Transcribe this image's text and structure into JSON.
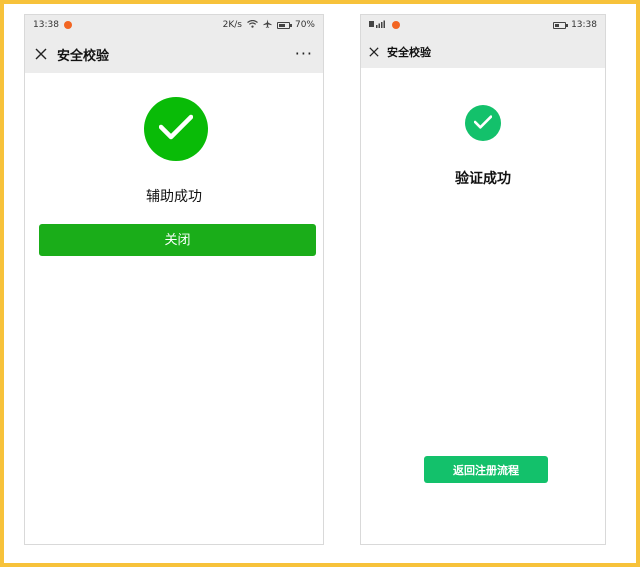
{
  "left_screen": {
    "status_bar": {
      "time": "13:38",
      "network_speed": "2K/s",
      "battery_percent": "70%",
      "battery_level": 0.7
    },
    "nav": {
      "title": "安全校验",
      "more_label": "···"
    },
    "result_text": "辅助成功",
    "close_button_label": "关闭",
    "colors": {
      "accent": "#1aad19",
      "check": "#09bb07"
    }
  },
  "right_screen": {
    "status_bar": {
      "time": "13:38",
      "battery_level": 0.4
    },
    "nav": {
      "title": "安全校验"
    },
    "result_text": "验证成功",
    "return_button_label": "返回注册流程",
    "colors": {
      "accent": "#13c16b"
    }
  },
  "icons": {
    "close": "close-icon",
    "check": "check-icon",
    "wifi": "wifi-icon",
    "airplane": "airplane-icon",
    "battery": "battery-icon",
    "signal": "signal-icon",
    "notification": "notification-icon"
  }
}
